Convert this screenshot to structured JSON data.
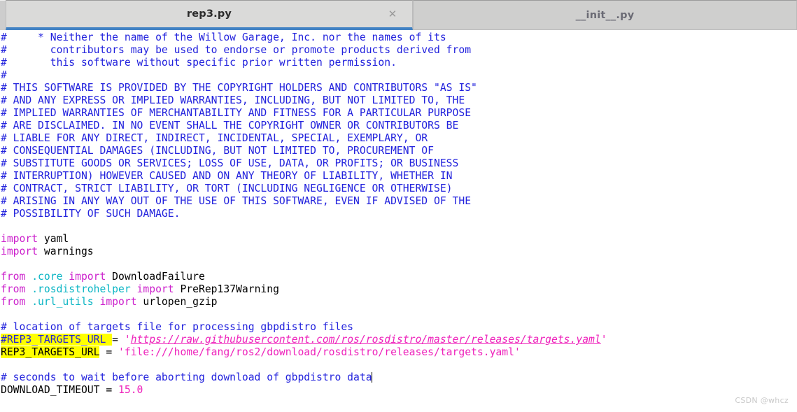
{
  "window": {
    "title": "rep3.py"
  },
  "tabbar": {
    "tabs": [
      {
        "label": "rep3.py",
        "active": true,
        "close_glyph": "✕"
      },
      {
        "label": "__init__.py",
        "active": false
      }
    ],
    "active_indicator_color": "#4182c4"
  },
  "colors": {
    "comment": "#2222dd",
    "keyword": "#cc22cc",
    "module": "#0bb5c4",
    "string": "#ee22bb",
    "number": "#ee22bb",
    "identifier": "#000000",
    "search_highlight": "#ffff00",
    "editor_background": "#ffffff",
    "tab_active_background": "#dadad9",
    "tab_inactive_background": "#cfcfce"
  },
  "editor": {
    "filename": "rep3.py",
    "language": "python",
    "caret_line": 27,
    "lines": [
      {
        "n": 1,
        "segs": [
          {
            "t": "#     * Neither the name of the Willow Garage, Inc. nor the names of its",
            "c": "cmt"
          }
        ]
      },
      {
        "n": 2,
        "segs": [
          {
            "t": "#       contributors may be used to endorse or promote products derived from",
            "c": "cmt"
          }
        ]
      },
      {
        "n": 3,
        "segs": [
          {
            "t": "#       this software without specific prior written permission.",
            "c": "cmt"
          }
        ]
      },
      {
        "n": 4,
        "segs": [
          {
            "t": "#",
            "c": "cmt"
          }
        ]
      },
      {
        "n": 5,
        "segs": [
          {
            "t": "# THIS SOFTWARE IS PROVIDED BY THE COPYRIGHT HOLDERS AND CONTRIBUTORS \"AS IS\"",
            "c": "cmt"
          }
        ]
      },
      {
        "n": 6,
        "segs": [
          {
            "t": "# AND ANY EXPRESS OR IMPLIED WARRANTIES, INCLUDING, BUT NOT LIMITED TO, THE",
            "c": "cmt"
          }
        ]
      },
      {
        "n": 7,
        "segs": [
          {
            "t": "# IMPLIED WARRANTIES OF MERCHANTABILITY AND FITNESS FOR A PARTICULAR PURPOSE",
            "c": "cmt"
          }
        ]
      },
      {
        "n": 8,
        "segs": [
          {
            "t": "# ARE DISCLAIMED. IN NO EVENT SHALL THE COPYRIGHT OWNER OR CONTRIBUTORS BE",
            "c": "cmt"
          }
        ]
      },
      {
        "n": 9,
        "segs": [
          {
            "t": "# LIABLE FOR ANY DIRECT, INDIRECT, INCIDENTAL, SPECIAL, EXEMPLARY, OR",
            "c": "cmt"
          }
        ]
      },
      {
        "n": 10,
        "segs": [
          {
            "t": "# CONSEQUENTIAL DAMAGES (INCLUDING, BUT NOT LIMITED TO, PROCUREMENT OF",
            "c": "cmt"
          }
        ]
      },
      {
        "n": 11,
        "segs": [
          {
            "t": "# SUBSTITUTE GOODS OR SERVICES; LOSS OF USE, DATA, OR PROFITS; OR BUSINESS",
            "c": "cmt"
          }
        ]
      },
      {
        "n": 12,
        "segs": [
          {
            "t": "# INTERRUPTION) HOWEVER CAUSED AND ON ANY THEORY OF LIABILITY, WHETHER IN",
            "c": "cmt"
          }
        ]
      },
      {
        "n": 13,
        "segs": [
          {
            "t": "# CONTRACT, STRICT LIABILITY, OR TORT (INCLUDING NEGLIGENCE OR OTHERWISE)",
            "c": "cmt"
          }
        ]
      },
      {
        "n": 14,
        "segs": [
          {
            "t": "# ARISING IN ANY WAY OUT OF THE USE OF THIS SOFTWARE, EVEN IF ADVISED OF THE",
            "c": "cmt"
          }
        ]
      },
      {
        "n": 15,
        "segs": [
          {
            "t": "# POSSIBILITY OF SUCH DAMAGE.",
            "c": "cmt"
          }
        ]
      },
      {
        "n": 16,
        "segs": []
      },
      {
        "n": 17,
        "segs": [
          {
            "t": "import",
            "c": "kw"
          },
          {
            "t": " yaml",
            "c": "name"
          }
        ]
      },
      {
        "n": 18,
        "segs": [
          {
            "t": "import",
            "c": "kw"
          },
          {
            "t": " warnings",
            "c": "name"
          }
        ]
      },
      {
        "n": 19,
        "segs": []
      },
      {
        "n": 20,
        "segs": [
          {
            "t": "from",
            "c": "kw"
          },
          {
            "t": " ",
            "c": "name"
          },
          {
            "t": ".core",
            "c": "mod"
          },
          {
            "t": " ",
            "c": "name"
          },
          {
            "t": "import",
            "c": "kw"
          },
          {
            "t": " DownloadFailure",
            "c": "name"
          }
        ]
      },
      {
        "n": 21,
        "segs": [
          {
            "t": "from",
            "c": "kw"
          },
          {
            "t": " ",
            "c": "name"
          },
          {
            "t": ".rosdistrohelper",
            "c": "mod"
          },
          {
            "t": " ",
            "c": "name"
          },
          {
            "t": "import",
            "c": "kw"
          },
          {
            "t": " PreRep137Warning",
            "c": "name"
          }
        ]
      },
      {
        "n": 22,
        "segs": [
          {
            "t": "from",
            "c": "kw"
          },
          {
            "t": " ",
            "c": "name"
          },
          {
            "t": ".url_utils",
            "c": "mod"
          },
          {
            "t": " ",
            "c": "name"
          },
          {
            "t": "import",
            "c": "kw"
          },
          {
            "t": " urlopen_gzip",
            "c": "name"
          }
        ]
      },
      {
        "n": 23,
        "segs": []
      },
      {
        "n": 24,
        "segs": [
          {
            "t": "# location of targets file for processing gbpdistro files",
            "c": "cmt"
          }
        ]
      },
      {
        "n": 25,
        "segs": [
          {
            "t": "#REP3_TARGETS_URL ",
            "c": "cmt hl"
          },
          {
            "t": "= ",
            "c": "op"
          },
          {
            "t": "'",
            "c": "str"
          },
          {
            "t": "https://raw.githubusercontent.com/ros/rosdistro/master/releases/targets.yaml",
            "c": "link"
          },
          {
            "t": "'",
            "c": "str"
          }
        ]
      },
      {
        "n": 26,
        "segs": [
          {
            "t": "REP3_TARGETS_URL",
            "c": "name hl"
          },
          {
            "t": " = ",
            "c": "op"
          },
          {
            "t": "'file:///home/fang/ros2/download/rosdistro/releases/targets.yaml'",
            "c": "str"
          }
        ]
      },
      {
        "n": 27,
        "segs": []
      },
      {
        "n": 28,
        "segs": [
          {
            "t": "# seconds to wait before aborting download of gbpdistro data",
            "c": "cmt",
            "caret_after": true
          }
        ]
      },
      {
        "n": 29,
        "segs": [
          {
            "t": "DOWNLOAD_TIMEOUT",
            "c": "name"
          },
          {
            "t": " = ",
            "c": "op"
          },
          {
            "t": "15.0",
            "c": "num"
          }
        ]
      }
    ]
  },
  "watermark": {
    "text": "CSDN @whcz"
  }
}
